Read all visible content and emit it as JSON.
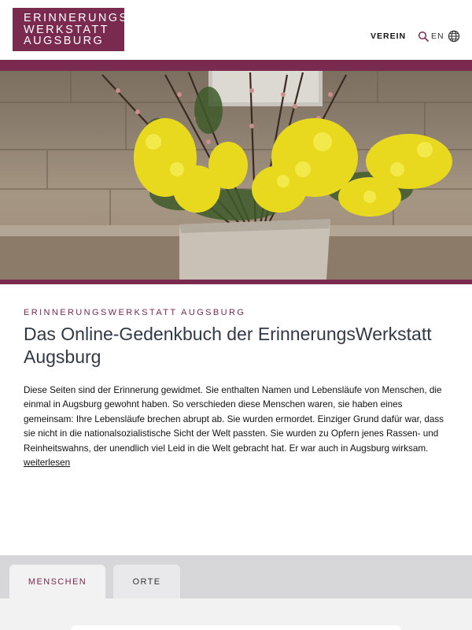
{
  "header": {
    "logo_lines": [
      "ERINNERUNGS",
      "WERKSTATT",
      "AUGSBURG"
    ],
    "nav_verein": "VEREIN",
    "lang": "EN",
    "icons": {
      "search": "search-icon",
      "globe": "globe-icon"
    }
  },
  "hero": {
    "alt_icon": "flower-bouquet-image"
  },
  "main": {
    "eyebrow": "ERINNERUNGSWERKSTATT AUGSBURG",
    "title": "Das Online-Gedenkbuch der ErinnerungsWerkstatt Augsburg",
    "intro": "Diese Seiten sind der Erinnerung gewidmet. Sie enthalten Namen und Lebensläufe von Menschen, die einmal in Augsburg gewohnt haben. So verschieden diese Menschen waren, sie haben eines gemeinsam: Ihre Lebensläufe brechen abrupt ab. Sie wurden ermordet. Einziger Grund dafür war, dass sie nicht in die nationalsozialistische Sicht der Welt passten. Sie wurden zu Opfern jenes Rassen- und Reinheitswahns, der unendlich viel Leid in die Welt gebracht hat. Er war auch in Augsburg wirksam.",
    "more_link": "weiterlesen"
  },
  "tabs": [
    {
      "label": "MENSCHEN",
      "active": true
    },
    {
      "label": "ORTE",
      "active": false
    }
  ],
  "colors": {
    "brand": "#7a2a4f",
    "title": "#2f3947",
    "tabs_bg": "#d7d7d9"
  }
}
